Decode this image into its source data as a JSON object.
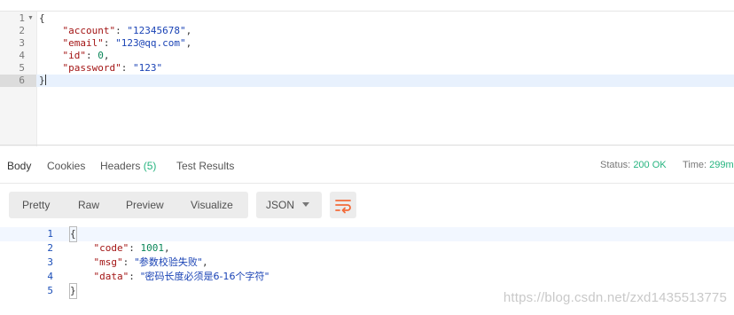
{
  "request_body": {
    "lines": [
      {
        "num": "1",
        "open": "{"
      },
      {
        "num": "2",
        "key": "\"account\"",
        "value": "\"12345678\"",
        "tail": ","
      },
      {
        "num": "3",
        "key": "\"email\"",
        "value": "\"123@qq.com\"",
        "tail": ","
      },
      {
        "num": "4",
        "key": "\"id\"",
        "value": "0",
        "tail": ","
      },
      {
        "num": "5",
        "key": "\"password\"",
        "value": "\"123\"",
        "tail": ""
      },
      {
        "num": "6",
        "close": "}"
      }
    ]
  },
  "response_tabs": {
    "body": "Body",
    "cookies": "Cookies",
    "headers": "Headers",
    "headers_count": "(5)",
    "test_results": "Test Results"
  },
  "status_bar": {
    "status_label": "Status:",
    "status_value": "200 OK",
    "time_label": "Time:",
    "time_value": "299m"
  },
  "view_toolbar": {
    "pretty": "Pretty",
    "raw": "Raw",
    "preview": "Preview",
    "visualize": "Visualize",
    "format": "JSON"
  },
  "response_body": {
    "lines": [
      {
        "num": "1",
        "open": "{"
      },
      {
        "num": "2",
        "key": "\"code\"",
        "value": "1001",
        "tail": ","
      },
      {
        "num": "3",
        "key": "\"msg\"",
        "value": "\"参数校验失败\"",
        "tail": ","
      },
      {
        "num": "4",
        "key": "\"data\"",
        "value": "\"密码长度必须是6-16个字符\"",
        "tail": ""
      },
      {
        "num": "5",
        "close": "}"
      }
    ]
  },
  "watermark": "https://blog.csdn.net/zxd1435513775",
  "colors": {
    "accent_green": "#26b47f",
    "accent_orange": "#f26b3a",
    "json_key": "#a31515",
    "json_string": "#1a43b5",
    "json_number": "#098658"
  }
}
